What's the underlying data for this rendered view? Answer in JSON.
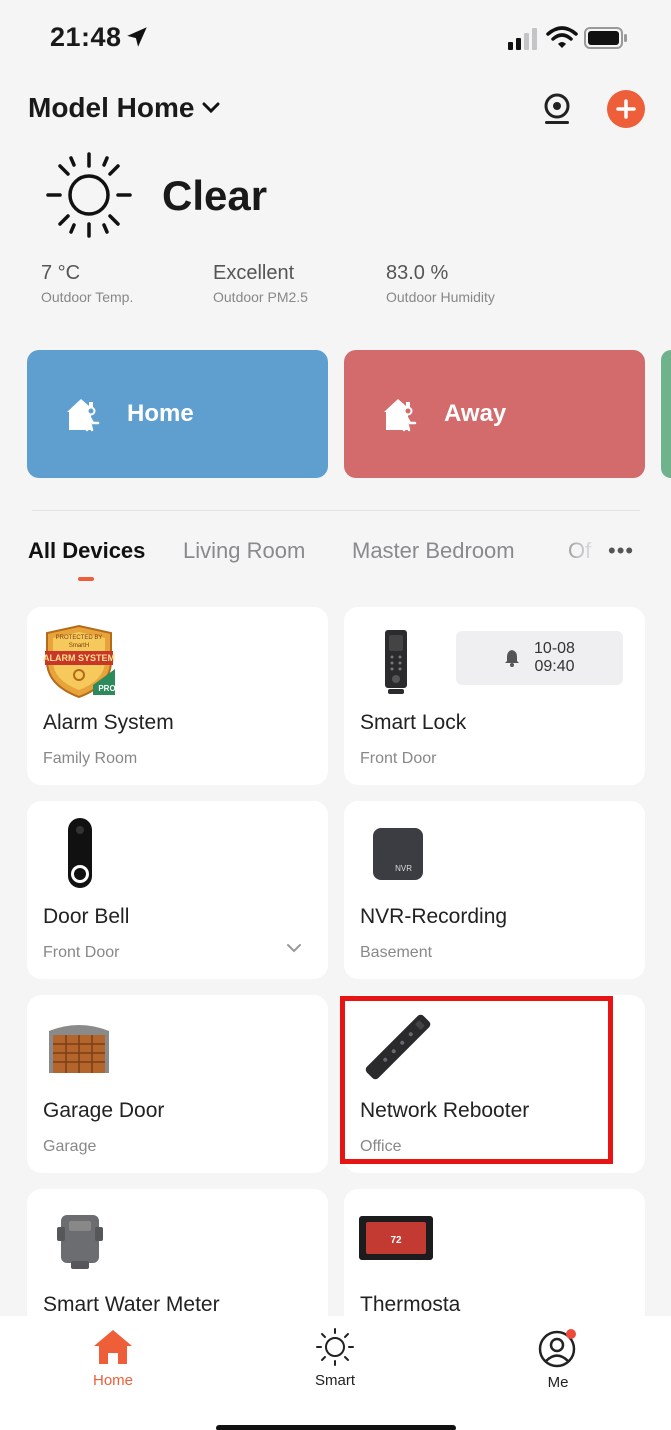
{
  "status_bar": {
    "time": "21:48"
  },
  "header": {
    "home_name": "Model Home",
    "chevron": "⌄"
  },
  "weather": {
    "condition": "Clear",
    "stats": [
      {
        "value": "7 °C",
        "label": "Outdoor Temp."
      },
      {
        "value": "Excellent",
        "label": "Outdoor PM2.5"
      },
      {
        "value": "83.0 %",
        "label": "Outdoor Humidity"
      }
    ]
  },
  "scenes": [
    {
      "label": "Home",
      "color": "#5f9fd0"
    },
    {
      "label": "Away",
      "color": "#d36a6b"
    }
  ],
  "tabs": [
    {
      "label": "All Devices",
      "active": true
    },
    {
      "label": "Living Room"
    },
    {
      "label": "Master Bedroom"
    },
    {
      "label": "Of"
    }
  ],
  "more": "•••",
  "devices": [
    {
      "name": "Alarm System",
      "room": "Family Room",
      "icon": "alarm-system-icon"
    },
    {
      "name": "Smart Lock",
      "room": "Front Door",
      "icon": "smart-lock-icon",
      "last_event_date": "10-08",
      "last_event_time": "09:40"
    },
    {
      "name": "Door Bell",
      "room": "Front Door",
      "icon": "doorbell-icon"
    },
    {
      "name": "NVR-Recording",
      "room": "Basement",
      "icon": "nvr-icon",
      "icon_text": "NVR"
    },
    {
      "name": "Garage Door",
      "room": "Garage",
      "icon": "garage-door-icon"
    },
    {
      "name": "Network Rebooter",
      "room": "Office",
      "icon": "power-strip-icon"
    },
    {
      "name": "Smart Water Meter",
      "room": "",
      "icon": "water-meter-icon"
    },
    {
      "name": "Thermosta",
      "room": "",
      "icon": "thermostat-icon",
      "icon_text": "72"
    }
  ],
  "badge_text": {
    "alarm_top": "PROTECTED BY",
    "alarm_mid": "ALARM SYSTEM",
    "alarm_brand": "SmartH",
    "alarm_pro": "PRO"
  },
  "bottom_nav": [
    {
      "label": "Home",
      "active": true
    },
    {
      "label": "Smart"
    },
    {
      "label": "Me"
    }
  ],
  "colors": {
    "accent": "#ee5e38",
    "highlight": "#e81313"
  }
}
